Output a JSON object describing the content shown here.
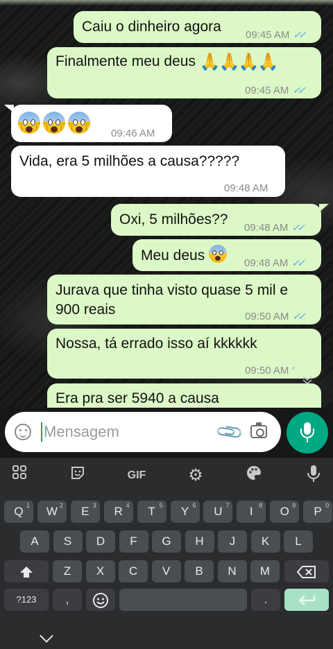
{
  "messages": [
    {
      "dir": "out",
      "text": "Caiu o dinheiro agora",
      "time": "09:45 AM",
      "ticks": "✓✓"
    },
    {
      "dir": "out",
      "text": "Finalmente meu deus",
      "emoji": "🙏🙏🙏🙏",
      "time": "09:45 AM",
      "ticks": "✓✓"
    },
    {
      "dir": "in",
      "emoji_name": "screaming-face",
      "time": "09:46 AM"
    },
    {
      "dir": "in",
      "text": "Vida, era 5 milhões a causa?????",
      "time": "09:48 AM"
    },
    {
      "dir": "out",
      "text": "Oxi, 5 milhões??",
      "time": "09:48 AM",
      "ticks": "✓✓"
    },
    {
      "dir": "out",
      "text": "Meu deus",
      "time": "09:48 AM",
      "ticks": "✓✓"
    },
    {
      "dir": "out",
      "text_line1": "Jurava que tinha visto quase 5 mil e",
      "text_line2": "900 reais",
      "time": "09:50 AM",
      "ticks": "✓✓"
    },
    {
      "dir": "out",
      "text": "Nossa, tá errado isso aí kkkkkk",
      "time": "09:50 AM",
      "ticks": "''"
    },
    {
      "dir": "out",
      "text": "Era pra ser 5940 a causa"
    }
  ],
  "input": {
    "placeholder": "Mensagem"
  },
  "keyboard": {
    "toolbar": {
      "gif_label": "GIF"
    },
    "row1": [
      {
        "k": "Q",
        "s": "1"
      },
      {
        "k": "W",
        "s": "2"
      },
      {
        "k": "E",
        "s": "3"
      },
      {
        "k": "R",
        "s": "4"
      },
      {
        "k": "T",
        "s": "5"
      },
      {
        "k": "Y",
        "s": "6"
      },
      {
        "k": "U",
        "s": "7"
      },
      {
        "k": "I",
        "s": "8"
      },
      {
        "k": "O",
        "s": "9"
      },
      {
        "k": "P",
        "s": "0"
      }
    ],
    "row2": [
      "A",
      "S",
      "D",
      "F",
      "G",
      "H",
      "J",
      "K",
      "L"
    ],
    "row3": [
      "Z",
      "X",
      "C",
      "V",
      "B",
      "N",
      "M"
    ],
    "symbols_label": "?123",
    "comma_label": ",",
    "period_label": "."
  },
  "colors": {
    "outgoing": "#dcf8c6",
    "incoming": "#ffffff",
    "accent": "#00a884",
    "ticks": "#4fa9e8"
  }
}
